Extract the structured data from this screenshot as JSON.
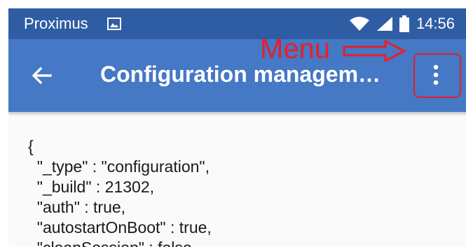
{
  "status_bar": {
    "carrier": "Proximus",
    "time": "14:56",
    "icons": [
      "gallery-icon",
      "wifi-icon",
      "signal-icon",
      "battery-icon"
    ]
  },
  "app_bar": {
    "title": "Configuration managem…",
    "back_icon": "arrow-left-icon",
    "menu_icon": "more-vert-icon"
  },
  "annotation": {
    "label": "Menu",
    "color": "#e4202a"
  },
  "content": {
    "lines": [
      "{",
      "  \"_type\" : \"configuration\",",
      "  \"_build\" : 21302,",
      "  \"auth\" : true,",
      "  \"autostartOnBoot\" : true,",
      "  \"cleanSession\" : false,"
    ]
  },
  "colors": {
    "status_bar": "#2f5da4",
    "app_bar": "#4578c5",
    "background": "#fafafa"
  }
}
